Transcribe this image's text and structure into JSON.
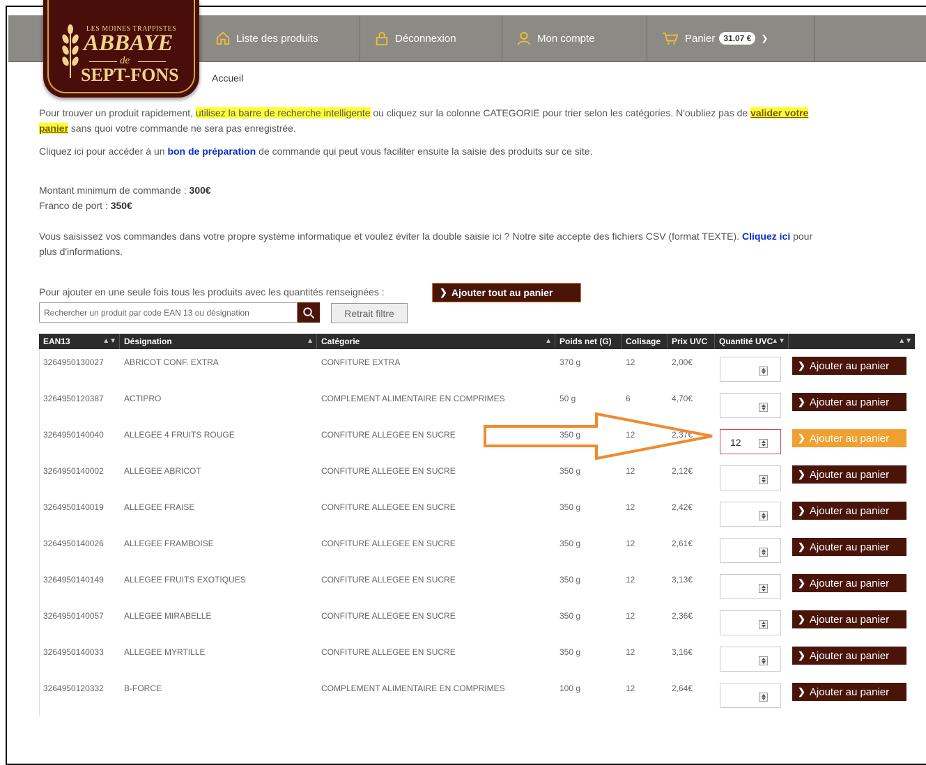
{
  "logo": {
    "line1": "LES MOINES TRAPPISTES",
    "line2": "ABBAYE",
    "line3": "de",
    "line4": "SEPT-FONS"
  },
  "nav": {
    "items": [
      {
        "label": "Liste des produits",
        "icon": "home-icon"
      },
      {
        "label": "Déconnexion",
        "icon": "lock-icon"
      },
      {
        "label": "Mon compte",
        "icon": "user-icon"
      },
      {
        "label": "Panier",
        "icon": "cart-icon",
        "badge": "31.07 €"
      }
    ]
  },
  "breadcrumb": "Accueil",
  "intro": {
    "p1_a": "Pour trouver un produit rapidement, ",
    "p1_hl": "utilisez la barre de recherche intelligente",
    "p1_b": " ou cliquez sur la colonne CATEGORIE pour trier selon les catégories. N'oubliez pas de ",
    "p1_link1": "valider votre",
    "p1_link2": "panier",
    "p1_c": " sans quoi votre commande ne sera pas enregistrée.",
    "p2_a": "Cliquez ici pour accéder à un ",
    "p2_link": "bon de préparation",
    "p2_b": " de commande qui peut vous faciliter ensuite la saisie des produits sur ce site.",
    "min_label": "Montant minimum de commande : ",
    "min_value": "300€",
    "franco_label": "Franco de port : ",
    "franco_value": "350€",
    "p3_a": "Vous saisissez vos commandes dans votre propre système informatique et voulez éviter la double saisie ici ? Notre site accepte des fichiers CSV (format TEXTE). ",
    "p3_link": "Cliquez ici",
    "p3_b": " pour",
    "p3_c": "plus d'informations.",
    "add_all_text": "Pour ajouter en une seule fois tous les produits avec les quantités renseignées :",
    "add_all_button": "Ajouter tout au panier"
  },
  "search": {
    "placeholder": "Rechercher un produit par code EAN 13 ou désignation",
    "reset_label": "Retrait filtre"
  },
  "table": {
    "headers": [
      "EAN13",
      "Désignation",
      "Catégorie",
      "Poids net (G)",
      "Colisage",
      "Prix UVC",
      "Quantité UVC",
      ""
    ],
    "add_label": "Ajouter au panier",
    "rows": [
      {
        "ean": "3264950130027",
        "name": "ABRICOT CONF. EXTRA",
        "cat": "CONFITURE EXTRA",
        "weight": "370 g",
        "pack": "12",
        "price": "2,00€",
        "qty": ""
      },
      {
        "ean": "3264950120387",
        "name": "ACTIPRO",
        "cat": "COMPLEMENT ALIMENTAIRE EN COMPRIMES",
        "weight": "50 g",
        "pack": "6",
        "price": "4,70€",
        "qty": ""
      },
      {
        "ean": "3264950140040",
        "name": "ALLEGEE 4 FRUITS ROUGE",
        "cat": "CONFITURE ALLEGEE EN SUCRE",
        "weight": "350 g",
        "pack": "12",
        "price": "2,37€",
        "qty": "12"
      },
      {
        "ean": "3264950140002",
        "name": "ALLEGEE ABRICOT",
        "cat": "CONFITURE ALLEGEE EN SUCRE",
        "weight": "350 g",
        "pack": "12",
        "price": "2,12€",
        "qty": ""
      },
      {
        "ean": "3264950140019",
        "name": "ALLEGEE FRAISE",
        "cat": "CONFITURE ALLEGEE EN SUCRE",
        "weight": "350 g",
        "pack": "12",
        "price": "2,42€",
        "qty": ""
      },
      {
        "ean": "3264950140026",
        "name": "ALLEGEE FRAMBOISE",
        "cat": "CONFITURE ALLEGEE EN SUCRE",
        "weight": "350 g",
        "pack": "12",
        "price": "2,61€",
        "qty": ""
      },
      {
        "ean": "3264950140149",
        "name": "ALLEGEE FRUITS EXOTIQUES",
        "cat": "CONFITURE ALLEGEE EN SUCRE",
        "weight": "350 g",
        "pack": "12",
        "price": "3,13€",
        "qty": ""
      },
      {
        "ean": "3264950140057",
        "name": "ALLEGEE MIRABELLE",
        "cat": "CONFITURE ALLEGEE EN SUCRE",
        "weight": "350 g",
        "pack": "12",
        "price": "2,36€",
        "qty": ""
      },
      {
        "ean": "3264950140033",
        "name": "ALLEGEE MYRTILLE",
        "cat": "CONFITURE ALLEGEE EN SUCRE",
        "weight": "350 g",
        "pack": "12",
        "price": "3,16€",
        "qty": ""
      },
      {
        "ean": "3264950120332",
        "name": "B-FORCE",
        "cat": "COMPLEMENT ALIMENTAIRE EN COMPRIMES",
        "weight": "100 g",
        "pack": "12",
        "price": "2,64€",
        "qty": ""
      }
    ]
  },
  "colors": {
    "nav_bg": "#8c8a84",
    "brand_dark": "#4a1408",
    "accent_orange": "#f0a030",
    "arrow": "#f08a30",
    "link_blue": "#0a30c8"
  }
}
